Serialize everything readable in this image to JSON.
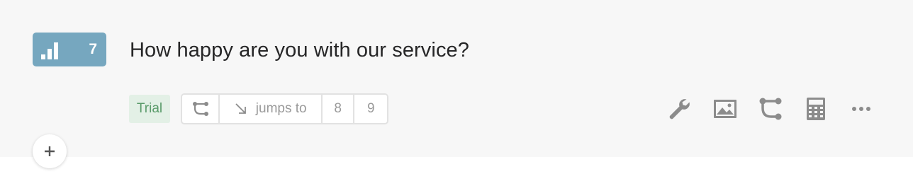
{
  "question": {
    "type_icon": "opinion-scale-icon",
    "number": "7",
    "title": "How happy are you with our service?",
    "badge_color": "#76a7bf"
  },
  "tags": {
    "trial_label": "Trial"
  },
  "logic": {
    "branch_icon": "branch-icon",
    "jump_icon": "arrow-down-right-icon",
    "jumps_label": "jumps to",
    "targets": [
      "8",
      "9"
    ]
  },
  "toolbar": {
    "icons": [
      "wrench-icon",
      "image-icon",
      "logic-jump-icon",
      "calculator-icon",
      "more-icon"
    ]
  },
  "add_button": {
    "icon": "plus-icon"
  },
  "colors": {
    "card_bg": "#f7f7f7",
    "trial_bg": "#e3f0e6",
    "trial_text": "#5a9b6a",
    "icon_gray": "#8c8c8c"
  }
}
